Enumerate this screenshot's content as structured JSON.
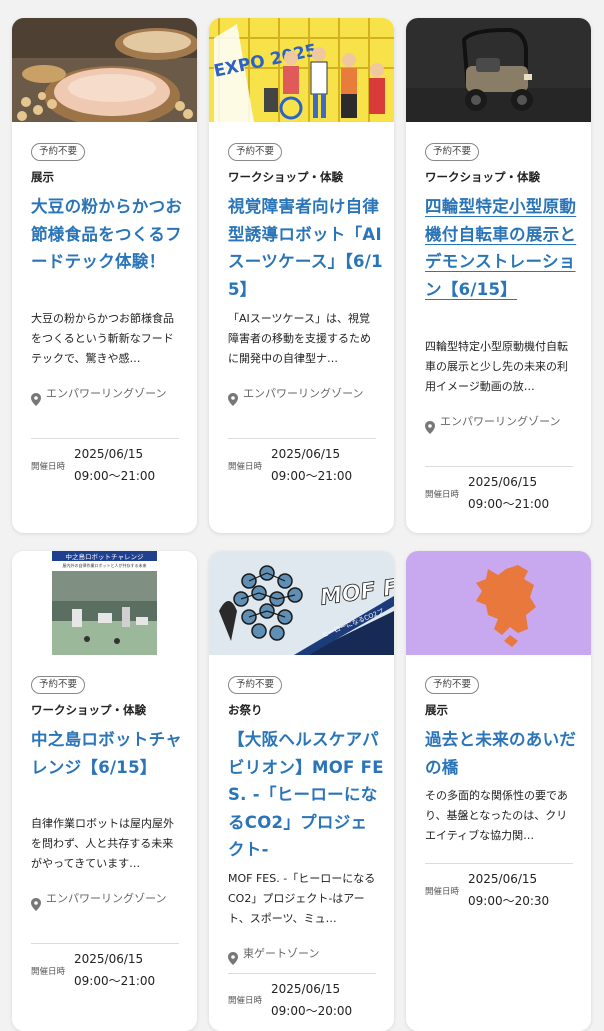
{
  "badge": "予約不要",
  "date_label": "開催日時",
  "cards": [
    {
      "category": "展示",
      "title": "大豆の粉からかつお節様食品をつくるフードテック体験！",
      "description": "大豆の粉からかつお節様食品をつくるという斬新なフードテックで、驚きや感…",
      "location": "エンパワーリングゾーン",
      "date": "2025/06/15",
      "time": "09:00～21:00"
    },
    {
      "category": "ワークショップ・体験",
      "title": "視覚障害者向け自律型誘導ロボット「AIスーツケース」【6/15】",
      "description": "「AIスーツケース」は、視覚障害者の移動を支援するために開発中の自律型ナ…",
      "location": "エンパワーリングゾーン",
      "date": "2025/06/15",
      "time": "09:00～21:00",
      "image_text": "EXPO 2025"
    },
    {
      "category": "ワークショップ・体験",
      "title": "四輪型特定小型原動機付自転車の展示とデモンストレーション【6/15】",
      "description": "四輪型特定小型原動機付自転車の展示と少し先の未来の利用イメージ動画の放…",
      "location": "エンパワーリングゾーン",
      "date": "2025/06/15",
      "time": "09:00～21:00"
    },
    {
      "category": "ワークショップ・体験",
      "title": "中之島ロボットチャレンジ【6/15】",
      "description": "自律作業ロボットは屋内屋外を問わず、人と共存する未来がやってきています…",
      "location": "エンパワーリングゾーン",
      "date": "2025/06/15",
      "time": "09:00～21:00",
      "image_banner": "中之島ロボットチャレンジ",
      "image_sub": "屋内外の自律作業ロボットと人が共存する未来"
    },
    {
      "category": "お祭り",
      "title": "【大阪ヘルスケアパビリオン】MOF FES. -「ヒーローになるCO2」プロジェクト-",
      "description": "MOF FES. -「ヒーローになるCO2」プロジェクト-はアート、スポーツ、ミュ…",
      "location": "東ゲートゾーン",
      "date": "2025/06/15",
      "time": "09:00～20:00",
      "image_text": "MOF FES",
      "image_sub": "ヒーローになるCO2プ"
    },
    {
      "category": "展示",
      "title": "過去と未来のあいだの橋",
      "description": "その多面的な関係性の要であり、基盤となったのは、クリエイティブな協力関…",
      "date": "2025/06/15",
      "time": "09:00～20:30"
    }
  ]
}
